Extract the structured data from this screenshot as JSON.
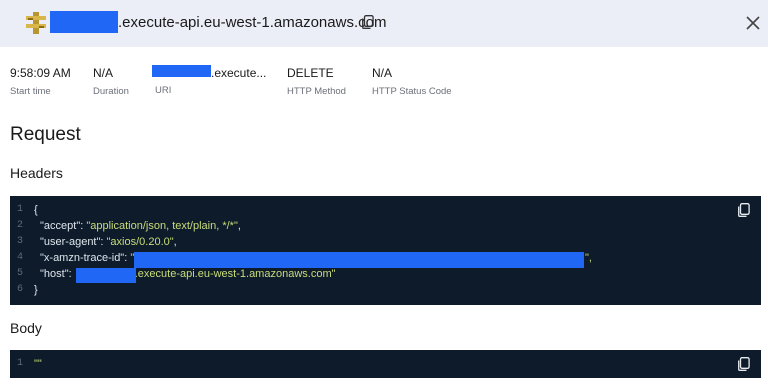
{
  "header": {
    "host_suffix": ".execute-api.eu-west-1.amazonaws.com"
  },
  "summary": {
    "start_time": {
      "value": "9:58:09 AM",
      "label": "Start time"
    },
    "duration": {
      "value": "N/A",
      "label": "Duration"
    },
    "uri": {
      "value": ".execute...",
      "label": "URI"
    },
    "http_method": {
      "value": "DELETE",
      "label": "HTTP Method"
    },
    "http_status": {
      "value": "N/A",
      "label": "HTTP Status Code"
    }
  },
  "request": {
    "title": "Request",
    "headers_title": "Headers",
    "body_title": "Body",
    "header_lines": [
      {
        "num": "1",
        "text": "{"
      },
      {
        "num": "2",
        "key": "\"accept\"",
        "value": "\"application/json, text/plain, */*\"",
        "tail": ","
      },
      {
        "num": "3",
        "key": "\"user-agent\"",
        "value": "\"axios/0.20.0\"",
        "tail": ","
      },
      {
        "num": "4",
        "key": "\"x-amzn-trace-id\"",
        "value": "\"",
        "tail": "\","
      },
      {
        "num": "5",
        "key": "\"host\"",
        "value": ".execute-api.eu-west-1.amazonaws.com\"",
        "tail": ""
      },
      {
        "num": "6",
        "text": "}"
      }
    ],
    "body_lines": [
      {
        "num": "1",
        "text": "\"\""
      }
    ]
  }
}
